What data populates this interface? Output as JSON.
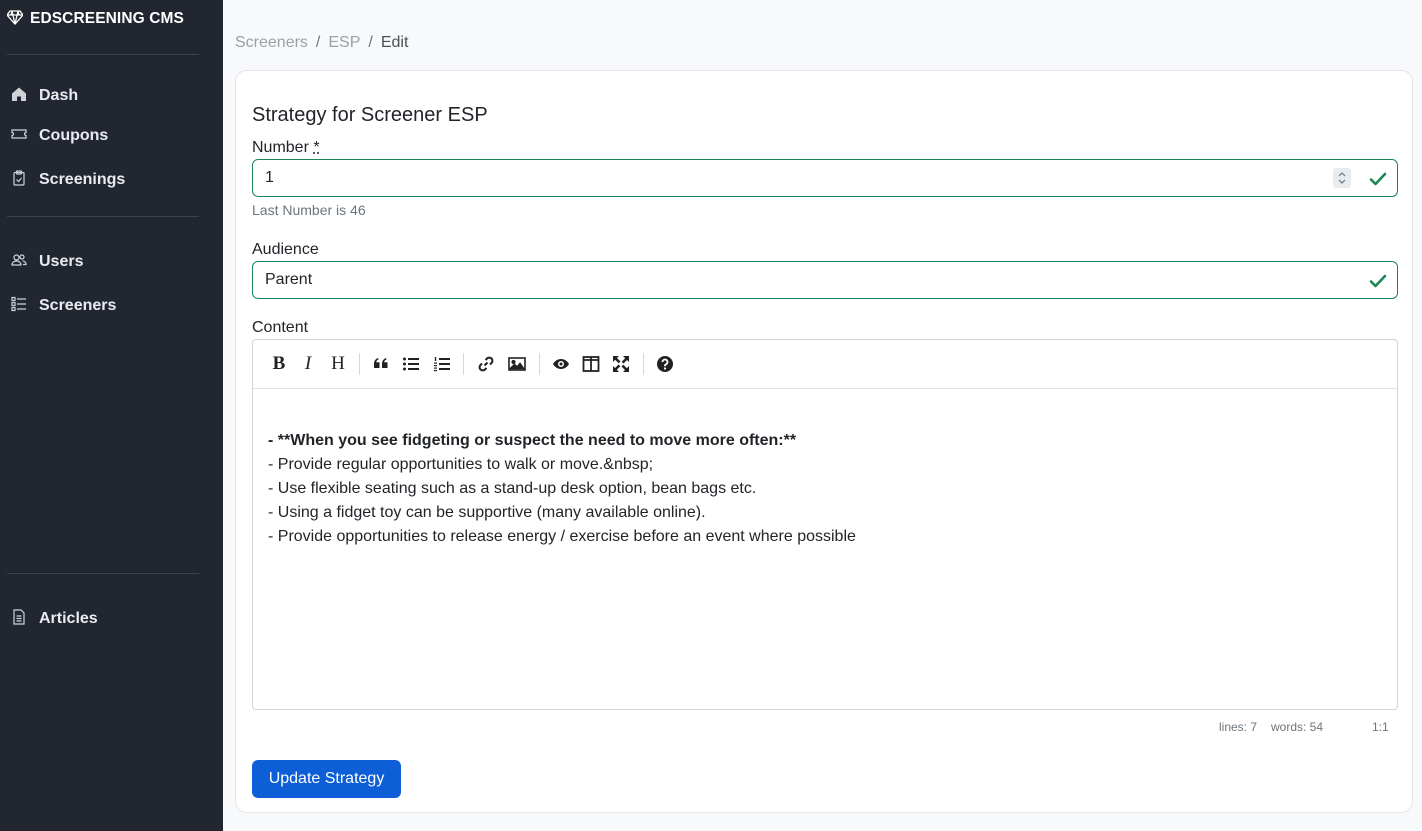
{
  "sidebar": {
    "brand": "EDSCREENING CMS",
    "items": [
      {
        "label": "Dash",
        "icon": "home-icon"
      },
      {
        "label": "Coupons",
        "icon": "ticket-icon"
      },
      {
        "label": "Screenings",
        "icon": "clipboard-icon"
      },
      {
        "label": "Users",
        "icon": "users-icon"
      },
      {
        "label": "Screeners",
        "icon": "list-icon"
      },
      {
        "label": "Articles",
        "icon": "document-icon"
      }
    ]
  },
  "breadcrumb": {
    "items": [
      "Screeners",
      "ESP",
      "Edit"
    ],
    "separator": "/"
  },
  "form": {
    "title": "Strategy for Screener ESP",
    "number_label": "Number",
    "required_mark": "*",
    "number_value": "1",
    "number_help": "Last Number is 46",
    "audience_label": "Audience",
    "audience_value": "Parent",
    "content_label": "Content",
    "submit_label": "Update Strategy"
  },
  "editor": {
    "toolbar": [
      "bold",
      "italic",
      "heading",
      "quote",
      "unordered-list",
      "ordered-list",
      "link",
      "image",
      "preview",
      "side-by-side",
      "fullscreen",
      "guide"
    ],
    "lines": [
      "- **When you see fidgeting or suspect the need to move more often:**",
      "- Provide regular opportunities to walk or move.&nbsp;",
      "- Use flexible seating such as a stand-up desk option, bean bags etc.",
      "- Using a fidget toy can be supportive (many available online).",
      "- Provide opportunities to release energy / exercise before an event where possible"
    ],
    "status_lines": "lines: 7",
    "status_words": "words: 54",
    "status_cursor": "1:1"
  },
  "colors": {
    "sidebar_bg": "#212631",
    "valid_green": "#198754",
    "primary_button": "#0d5ed7"
  }
}
